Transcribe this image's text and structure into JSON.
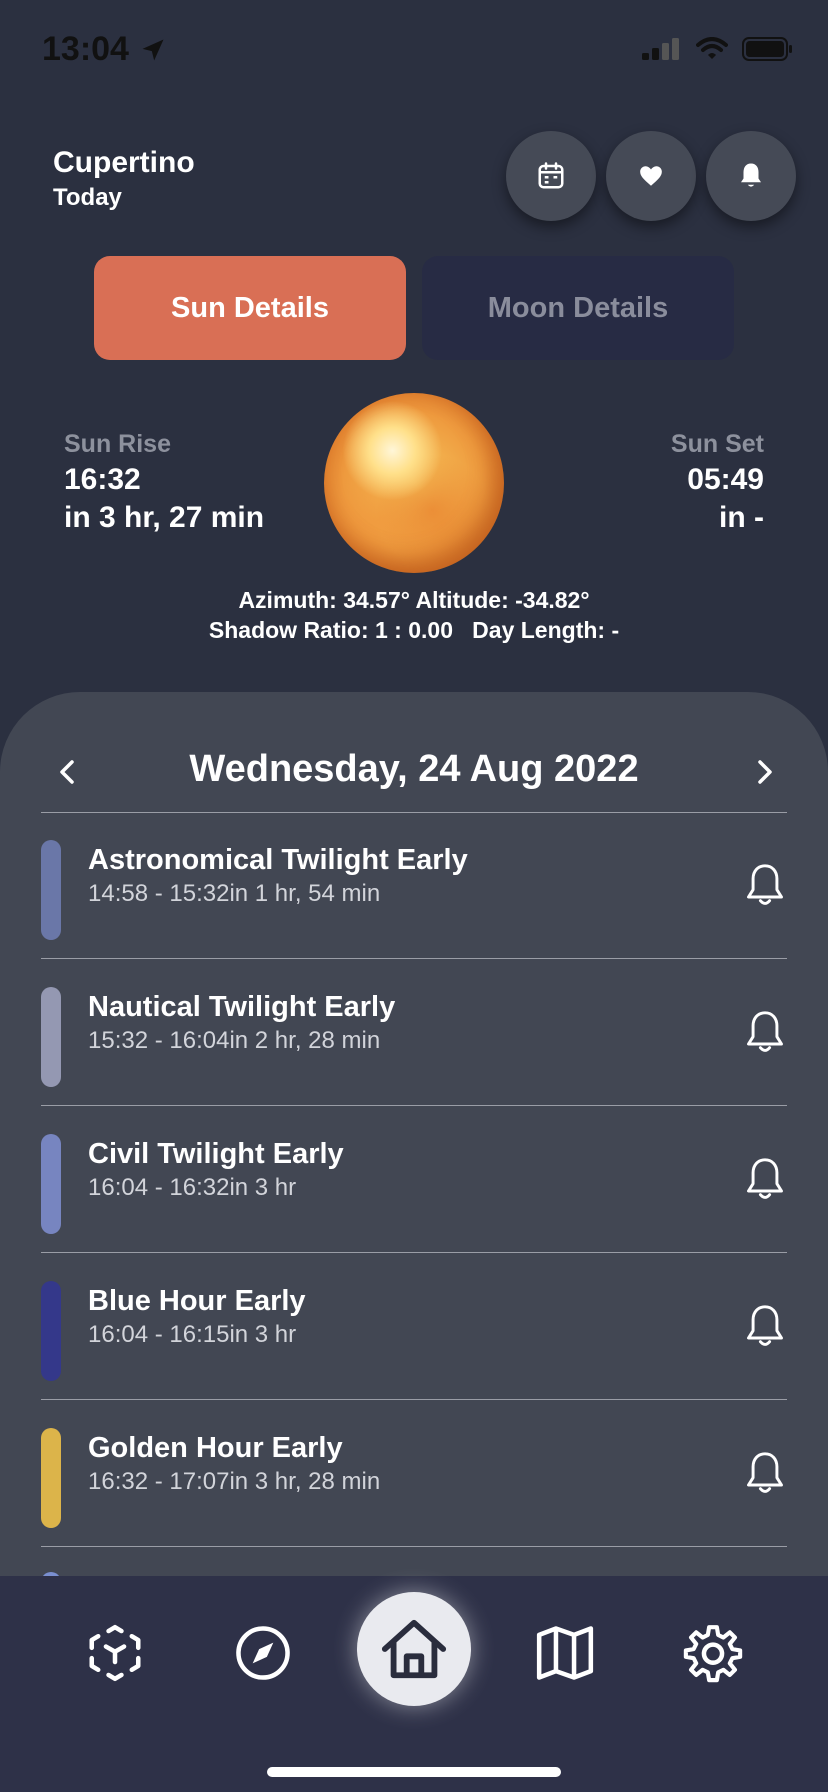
{
  "status": {
    "time": "13:04"
  },
  "header": {
    "location": "Cupertino",
    "day": "Today",
    "buttons": {
      "calendar": "calendar-icon",
      "favorite": "heart-icon",
      "notifications": "bell-icon"
    }
  },
  "tabs": [
    {
      "label": "Sun Details",
      "active": true
    },
    {
      "label": "Moon Details",
      "active": false
    }
  ],
  "sun": {
    "rise_label": "Sun Rise",
    "rise_time": "16:32",
    "rise_relative": "in 3 hr, 27 min",
    "set_label": "Sun Set",
    "set_time": "05:49",
    "set_relative": "in -",
    "info_line1": "Azimuth: 34.57° Altitude: -34.82°",
    "info_line2": "Shadow Ratio: 1 : 0.00   Day Length: -"
  },
  "date": {
    "title": "Wednesday, 24 Aug 2022"
  },
  "events": [
    {
      "title": "Astronomical Twilight Early",
      "time": "14:58 - 15:32in 1 hr, 54 min",
      "color": "#6a77a8"
    },
    {
      "title": "Nautical Twilight Early",
      "time": "15:32 - 16:04in 2 hr, 28 min",
      "color": "#9498b2"
    },
    {
      "title": "Civil Twilight Early",
      "time": "16:04 - 16:32in 3 hr",
      "color": "#7785c0"
    },
    {
      "title": "Blue Hour Early",
      "time": "16:04 - 16:15in 3 hr",
      "color": "#34388a"
    },
    {
      "title": "Golden Hour Early",
      "time": "16:32 - 17:07in 3 hr, 28 min",
      "color": "#dcb44a"
    }
  ],
  "tabbar": {
    "items": [
      "ar-cube-icon",
      "compass-icon",
      "home-icon",
      "map-icon",
      "settings-icon"
    ],
    "active": "home-icon"
  },
  "colors": {
    "background": "#2b3040",
    "sheet": "#424753",
    "accent": "#d96f55",
    "tabbar": "#2e3148"
  }
}
